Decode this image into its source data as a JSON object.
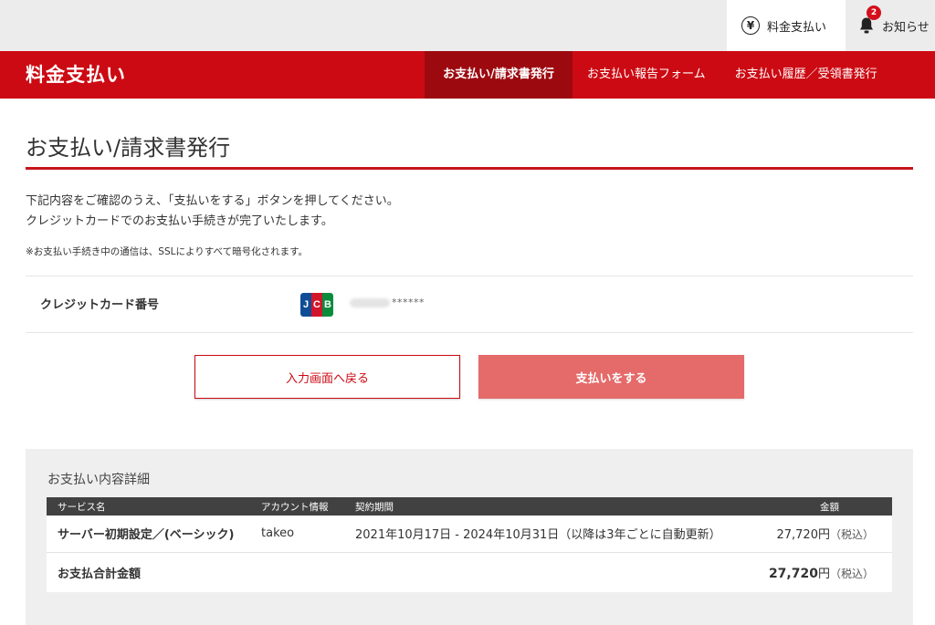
{
  "topbar": {
    "pay_label": "料金支払い",
    "pay_icon": "yen-circle-icon",
    "notice_label": "お知らせ",
    "notice_icon": "bell-icon",
    "notice_count": "2"
  },
  "header": {
    "brand": "料金支払い",
    "nav": [
      {
        "label": "お支払い/請求書発行",
        "active": true
      },
      {
        "label": "お支払い報告フォーム",
        "active": false
      },
      {
        "label": "お支払い履歴／受領書発行",
        "active": false
      }
    ]
  },
  "main": {
    "title": "お支払い/請求書発行",
    "desc_line1": "下記内容をご確認のうえ、「支払いをする」ボタンを押してください。",
    "desc_line2": "クレジットカードでのお支払い手続きが完了いたします。",
    "note": "※お支払い手続き中の通信は、SSLによりすべて暗号化されます。",
    "card": {
      "label": "クレジットカード番号",
      "brand_letters": [
        "J",
        "C",
        "B"
      ],
      "masked_number": "******"
    },
    "buttons": {
      "back": "入力画面へ戻る",
      "pay": "支払いをする"
    }
  },
  "detail": {
    "title": "お支払い内容詳細",
    "columns": [
      "サービス名",
      "アカウント情報",
      "契約期間",
      "金額"
    ],
    "rows": [
      {
        "service": "サーバー初期設定／(ベーシック)",
        "account": "takeo",
        "period": "2021年10月17日 - 2024年10月31日（以降は3年ごとに自動更新）",
        "amount": "27,720円",
        "tax": "（税込）"
      }
    ],
    "total_label": "お支払合計金額",
    "total_amount": "27,720",
    "total_unit": "円",
    "total_tax": "（税込）"
  },
  "colors": {
    "brand_red": "#cc0a13",
    "nav_active": "#9c0a10",
    "pay_button": "#e56a6a",
    "table_header": "#414141"
  }
}
